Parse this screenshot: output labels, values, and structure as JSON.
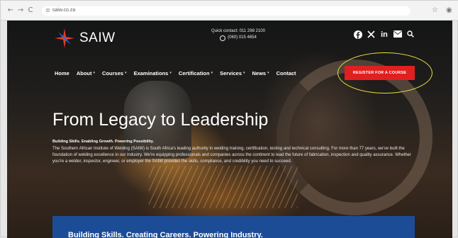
{
  "browser": {
    "back_icon": "←",
    "forward_icon": "→",
    "reload_icon": "C",
    "home_icon": "⌂",
    "url": "saiw.co.za",
    "star_icon": "☆",
    "profile_icon": "◉"
  },
  "header": {
    "logo_text": "SAIW",
    "contact_line1": "Quick contact: 011 298 2100",
    "contact_line2": "(060) 015 4654",
    "social": [
      "facebook-icon",
      "x-icon",
      "linkedin-icon",
      "mail-icon",
      "search-icon"
    ]
  },
  "nav": {
    "items": [
      {
        "label": "Home",
        "has_dropdown": false
      },
      {
        "label": "About",
        "has_dropdown": true
      },
      {
        "label": "Courses",
        "has_dropdown": true
      },
      {
        "label": "Examinations",
        "has_dropdown": true
      },
      {
        "label": "Certification",
        "has_dropdown": true
      },
      {
        "label": "Services",
        "has_dropdown": true
      },
      {
        "label": "News",
        "has_dropdown": true
      },
      {
        "label": "Contact",
        "has_dropdown": false
      }
    ],
    "caret": "▾",
    "cta_label": "REGISTER FOR A COURSE"
  },
  "hero": {
    "title": "From Legacy to Leadership",
    "subtitle": "Building Skills. Enabling Growth. Powering Possibility.",
    "body": "The Southern African Institute of Welding (SAIW) is South Africa's leading authority in welding training, certification, testing and technical consulting. For more than 77 years, we've built the foundation of welding excellence in our industry. We're equipping professionals and companies across the continent to lead the future of fabrication, inspection and quality assurance. Whether you're a welder, inspector, engineer, or employer the SAIW provides the skills, compliance, and credibility you need to succeed."
  },
  "band": {
    "text": "Building Skills. Creating Careers. Powering Industry."
  },
  "colors": {
    "cta": "#e02020",
    "band": "#1d4c97",
    "highlight": "#e7df3d"
  }
}
